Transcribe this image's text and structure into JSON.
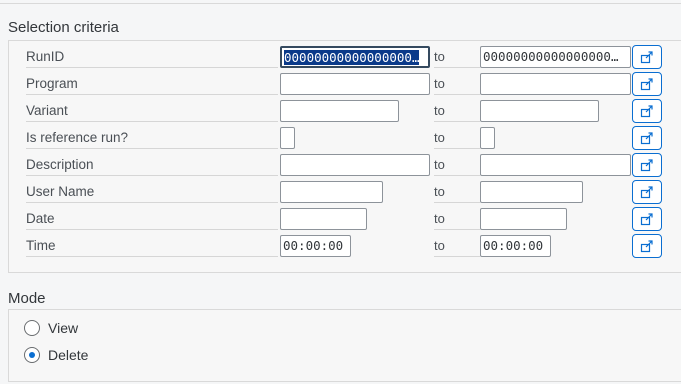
{
  "selection": {
    "title": "Selection criteria",
    "rows": [
      {
        "label": "RunID",
        "to": "to",
        "low": "000000000000000000",
        "high": "000000000000000000",
        "low_display": "00000000000000000",
        "high_display": "00000000000000000"
      },
      {
        "label": "Program",
        "to": "to",
        "low": "",
        "high": ""
      },
      {
        "label": "Variant",
        "to": "to",
        "low": "",
        "high": ""
      },
      {
        "label": "Is reference run?",
        "to": "to",
        "low": "",
        "high": ""
      },
      {
        "label": "Description",
        "to": "to",
        "low": "",
        "high": ""
      },
      {
        "label": "User Name",
        "to": "to",
        "low": "",
        "high": ""
      },
      {
        "label": "Date",
        "to": "to",
        "low": "",
        "high": ""
      },
      {
        "label": "Time",
        "to": "to",
        "low": "00:00:00",
        "high": "00:00:00"
      }
    ],
    "multi_selection_icon": "multiple-selection-icon"
  },
  "mode": {
    "title": "Mode",
    "options": [
      {
        "label": "View",
        "checked": false
      },
      {
        "label": "Delete",
        "checked": true
      }
    ]
  },
  "colors": {
    "accent": "#0a6ed1",
    "selection_highlight": "#0a3a8a"
  }
}
